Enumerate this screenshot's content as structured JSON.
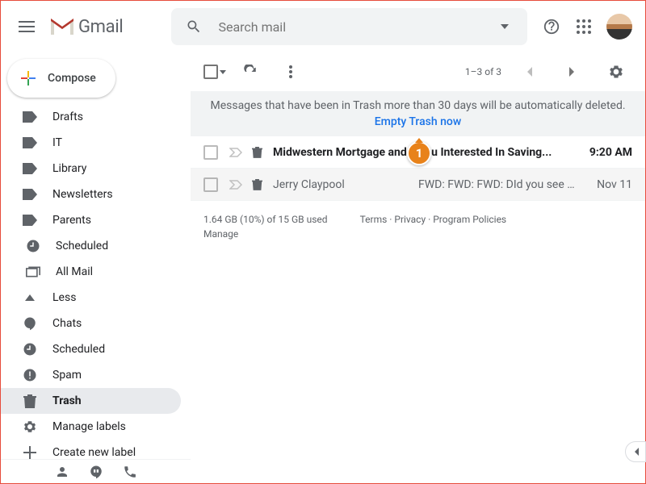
{
  "header": {
    "product": "Gmail",
    "search_placeholder": "Search mail"
  },
  "compose": {
    "label": "Compose"
  },
  "sidebar": {
    "items": [
      {
        "label": "Drafts",
        "icon": "label",
        "active": false
      },
      {
        "label": "IT",
        "icon": "label",
        "active": false
      },
      {
        "label": "Library",
        "icon": "label",
        "active": false
      },
      {
        "label": "Newsletters",
        "icon": "label",
        "active": false
      },
      {
        "label": "Parents",
        "icon": "label",
        "active": false
      },
      {
        "label": "Scheduled",
        "icon": "scheduled",
        "active": false,
        "indent": true
      },
      {
        "label": "All Mail",
        "icon": "allmail",
        "active": false,
        "indent": true
      },
      {
        "label": "Less",
        "icon": "less",
        "active": false
      },
      {
        "label": "Chats",
        "icon": "chats",
        "active": false
      },
      {
        "label": "Scheduled",
        "icon": "scheduled",
        "active": false
      },
      {
        "label": "Spam",
        "icon": "spam",
        "active": false
      },
      {
        "label": "Trash",
        "icon": "trash",
        "active": true
      },
      {
        "label": "Manage labels",
        "icon": "gear",
        "active": false
      },
      {
        "label": "Create new label",
        "icon": "plus",
        "active": false
      }
    ]
  },
  "toolbar": {
    "range": "1–3 of 3"
  },
  "banner": {
    "message": "Messages that have been in Trash more than 30 days will be automatically deleted.",
    "action": "Empty Trash now"
  },
  "messages": [
    {
      "sender": "Midwestern Mortgage and",
      "subject": "You Interested In Saving...",
      "date": "9:20 AM",
      "unread": true
    },
    {
      "sender": "Jerry Claypool",
      "subject": "FWD: FWD: FWD: DId you see ...",
      "date": "Nov 11",
      "unread": false
    }
  ],
  "footer": {
    "storage": "1.64 GB (10%) of 15 GB used",
    "manage": "Manage",
    "links": "Terms · Privacy · Program Policies"
  },
  "callout": {
    "num": "1"
  }
}
